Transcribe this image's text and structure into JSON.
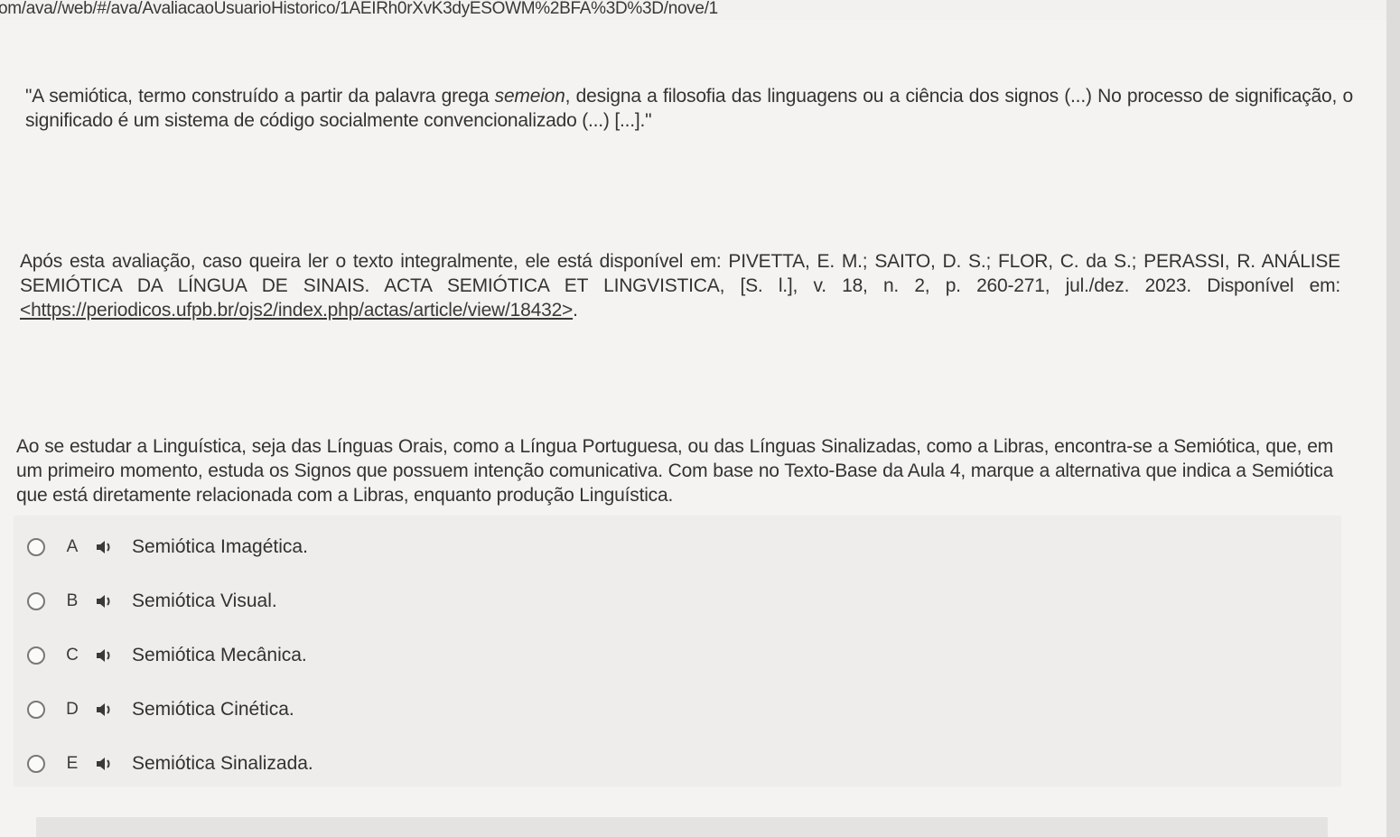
{
  "browser": {
    "url": "om/ava//web/#/ava/AvaliacaoUsuarioHistorico/1AEIRh0rXvK3dyESOWM%2BFA%3D%3D/nove/1"
  },
  "question": {
    "citation": {
      "before_em": "\"A semiótica, termo construído a partir da palavra grega ",
      "em": "semeion",
      "after_em": ", designa a filosofia das linguagens ou a ciência dos signos (...) No processo de significação, o significado é um sistema de código socialmente convencionalizado (...) [...].\""
    },
    "reference": {
      "text": "Após esta avaliação, caso queira ler o texto integralmente, ele está disponível em: PIVETTA, E. M.; SAITO, D. S.; FLOR, C. da S.; PERASSI, R. ANÁLISE SEMIÓTICA DA LÍNGUA DE SINAIS. ACTA SEMIÓTICA ET LINGVISTICA, [S. l.], v. 18, n. 2, p. 260-271, jul./dez. 2023. Disponível em: ",
      "link": "<https://periodicos.ufpb.br/ojs2/index.php/actas/article/view/18432>",
      "end": "."
    },
    "prompt": "Ao se estudar a Linguística, seja das Línguas Orais, como a Língua Portuguesa, ou das Línguas Sinalizadas, como a Libras, encontra-se a Semiótica, que, em um primeiro momento, estuda os Signos que possuem intenção comunicativa. Com base no Texto-Base da Aula 4, marque a alternativa que indica a Semiótica que está diretamente relacionada com a Libras, enquanto produção Linguística."
  },
  "options": [
    {
      "letter": "A",
      "text": "Semiótica Imagética.",
      "icon": "speaker-icon"
    },
    {
      "letter": "B",
      "text": "Semiótica Visual.",
      "icon": "speaker-icon"
    },
    {
      "letter": "C",
      "text": "Semiótica Mecânica.",
      "icon": "speaker-icon"
    },
    {
      "letter": "D",
      "text": "Semiótica Cinética.",
      "icon": "speaker-icon"
    },
    {
      "letter": "E",
      "text": "Semiótica Sinalizada.",
      "icon": "speaker-icon"
    }
  ]
}
